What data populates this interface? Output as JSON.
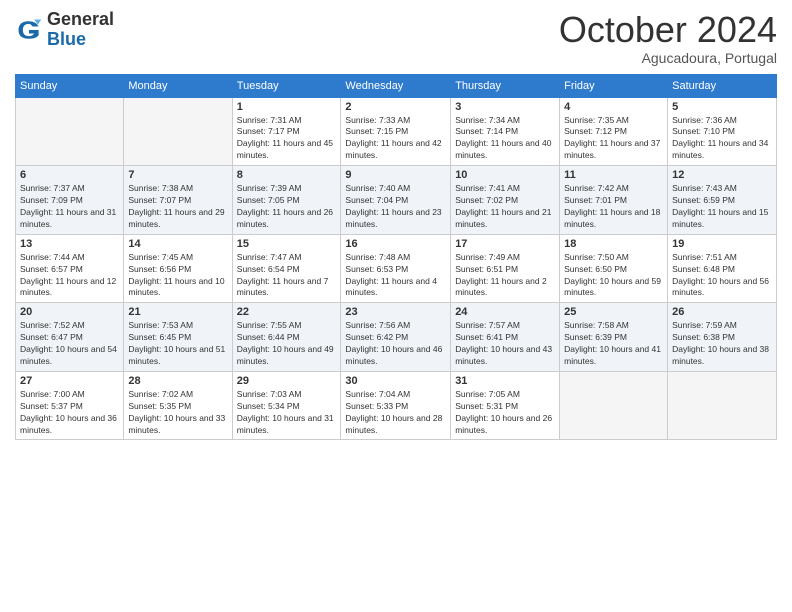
{
  "header": {
    "logo_general": "General",
    "logo_blue": "Blue",
    "month_year": "October 2024",
    "location": "Agucadoura, Portugal"
  },
  "days_of_week": [
    "Sunday",
    "Monday",
    "Tuesday",
    "Wednesday",
    "Thursday",
    "Friday",
    "Saturday"
  ],
  "weeks": [
    [
      {
        "day": "",
        "sunrise": "",
        "sunset": "",
        "daylight": ""
      },
      {
        "day": "",
        "sunrise": "",
        "sunset": "",
        "daylight": ""
      },
      {
        "day": "1",
        "sunrise": "Sunrise: 7:31 AM",
        "sunset": "Sunset: 7:17 PM",
        "daylight": "Daylight: 11 hours and 45 minutes."
      },
      {
        "day": "2",
        "sunrise": "Sunrise: 7:33 AM",
        "sunset": "Sunset: 7:15 PM",
        "daylight": "Daylight: 11 hours and 42 minutes."
      },
      {
        "day": "3",
        "sunrise": "Sunrise: 7:34 AM",
        "sunset": "Sunset: 7:14 PM",
        "daylight": "Daylight: 11 hours and 40 minutes."
      },
      {
        "day": "4",
        "sunrise": "Sunrise: 7:35 AM",
        "sunset": "Sunset: 7:12 PM",
        "daylight": "Daylight: 11 hours and 37 minutes."
      },
      {
        "day": "5",
        "sunrise": "Sunrise: 7:36 AM",
        "sunset": "Sunset: 7:10 PM",
        "daylight": "Daylight: 11 hours and 34 minutes."
      }
    ],
    [
      {
        "day": "6",
        "sunrise": "Sunrise: 7:37 AM",
        "sunset": "Sunset: 7:09 PM",
        "daylight": "Daylight: 11 hours and 31 minutes."
      },
      {
        "day": "7",
        "sunrise": "Sunrise: 7:38 AM",
        "sunset": "Sunset: 7:07 PM",
        "daylight": "Daylight: 11 hours and 29 minutes."
      },
      {
        "day": "8",
        "sunrise": "Sunrise: 7:39 AM",
        "sunset": "Sunset: 7:05 PM",
        "daylight": "Daylight: 11 hours and 26 minutes."
      },
      {
        "day": "9",
        "sunrise": "Sunrise: 7:40 AM",
        "sunset": "Sunset: 7:04 PM",
        "daylight": "Daylight: 11 hours and 23 minutes."
      },
      {
        "day": "10",
        "sunrise": "Sunrise: 7:41 AM",
        "sunset": "Sunset: 7:02 PM",
        "daylight": "Daylight: 11 hours and 21 minutes."
      },
      {
        "day": "11",
        "sunrise": "Sunrise: 7:42 AM",
        "sunset": "Sunset: 7:01 PM",
        "daylight": "Daylight: 11 hours and 18 minutes."
      },
      {
        "day": "12",
        "sunrise": "Sunrise: 7:43 AM",
        "sunset": "Sunset: 6:59 PM",
        "daylight": "Daylight: 11 hours and 15 minutes."
      }
    ],
    [
      {
        "day": "13",
        "sunrise": "Sunrise: 7:44 AM",
        "sunset": "Sunset: 6:57 PM",
        "daylight": "Daylight: 11 hours and 12 minutes."
      },
      {
        "day": "14",
        "sunrise": "Sunrise: 7:45 AM",
        "sunset": "Sunset: 6:56 PM",
        "daylight": "Daylight: 11 hours and 10 minutes."
      },
      {
        "day": "15",
        "sunrise": "Sunrise: 7:47 AM",
        "sunset": "Sunset: 6:54 PM",
        "daylight": "Daylight: 11 hours and 7 minutes."
      },
      {
        "day": "16",
        "sunrise": "Sunrise: 7:48 AM",
        "sunset": "Sunset: 6:53 PM",
        "daylight": "Daylight: 11 hours and 4 minutes."
      },
      {
        "day": "17",
        "sunrise": "Sunrise: 7:49 AM",
        "sunset": "Sunset: 6:51 PM",
        "daylight": "Daylight: 11 hours and 2 minutes."
      },
      {
        "day": "18",
        "sunrise": "Sunrise: 7:50 AM",
        "sunset": "Sunset: 6:50 PM",
        "daylight": "Daylight: 10 hours and 59 minutes."
      },
      {
        "day": "19",
        "sunrise": "Sunrise: 7:51 AM",
        "sunset": "Sunset: 6:48 PM",
        "daylight": "Daylight: 10 hours and 56 minutes."
      }
    ],
    [
      {
        "day": "20",
        "sunrise": "Sunrise: 7:52 AM",
        "sunset": "Sunset: 6:47 PM",
        "daylight": "Daylight: 10 hours and 54 minutes."
      },
      {
        "day": "21",
        "sunrise": "Sunrise: 7:53 AM",
        "sunset": "Sunset: 6:45 PM",
        "daylight": "Daylight: 10 hours and 51 minutes."
      },
      {
        "day": "22",
        "sunrise": "Sunrise: 7:55 AM",
        "sunset": "Sunset: 6:44 PM",
        "daylight": "Daylight: 10 hours and 49 minutes."
      },
      {
        "day": "23",
        "sunrise": "Sunrise: 7:56 AM",
        "sunset": "Sunset: 6:42 PM",
        "daylight": "Daylight: 10 hours and 46 minutes."
      },
      {
        "day": "24",
        "sunrise": "Sunrise: 7:57 AM",
        "sunset": "Sunset: 6:41 PM",
        "daylight": "Daylight: 10 hours and 43 minutes."
      },
      {
        "day": "25",
        "sunrise": "Sunrise: 7:58 AM",
        "sunset": "Sunset: 6:39 PM",
        "daylight": "Daylight: 10 hours and 41 minutes."
      },
      {
        "day": "26",
        "sunrise": "Sunrise: 7:59 AM",
        "sunset": "Sunset: 6:38 PM",
        "daylight": "Daylight: 10 hours and 38 minutes."
      }
    ],
    [
      {
        "day": "27",
        "sunrise": "Sunrise: 7:00 AM",
        "sunset": "Sunset: 5:37 PM",
        "daylight": "Daylight: 10 hours and 36 minutes."
      },
      {
        "day": "28",
        "sunrise": "Sunrise: 7:02 AM",
        "sunset": "Sunset: 5:35 PM",
        "daylight": "Daylight: 10 hours and 33 minutes."
      },
      {
        "day": "29",
        "sunrise": "Sunrise: 7:03 AM",
        "sunset": "Sunset: 5:34 PM",
        "daylight": "Daylight: 10 hours and 31 minutes."
      },
      {
        "day": "30",
        "sunrise": "Sunrise: 7:04 AM",
        "sunset": "Sunset: 5:33 PM",
        "daylight": "Daylight: 10 hours and 28 minutes."
      },
      {
        "day": "31",
        "sunrise": "Sunrise: 7:05 AM",
        "sunset": "Sunset: 5:31 PM",
        "daylight": "Daylight: 10 hours and 26 minutes."
      },
      {
        "day": "",
        "sunrise": "",
        "sunset": "",
        "daylight": ""
      },
      {
        "day": "",
        "sunrise": "",
        "sunset": "",
        "daylight": ""
      }
    ]
  ]
}
